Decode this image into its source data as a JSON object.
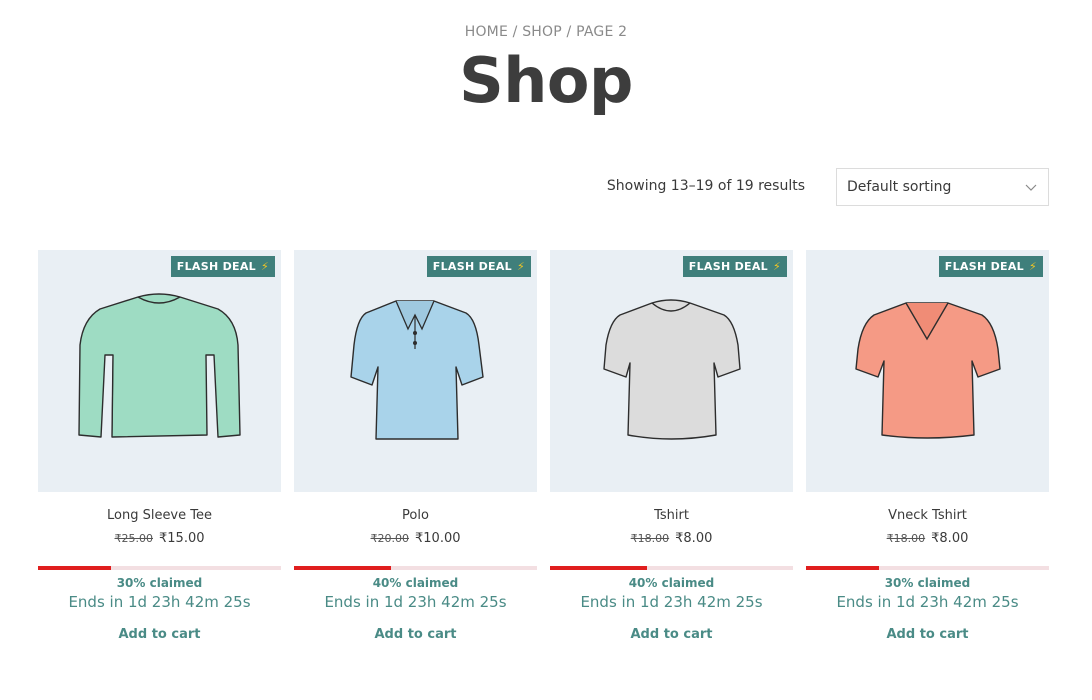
{
  "breadcrumb": {
    "home": "HOME",
    "sep1": " / ",
    "shop": "SHOP",
    "sep2": " / ",
    "page": "PAGE 2"
  },
  "title": "Shop",
  "result_count": "Showing 13–19 of 19 results",
  "sorting": {
    "selected": "Default sorting"
  },
  "colors": {
    "accent": "#3f7f7b",
    "progress": "#e01e1e",
    "thumb_bg": "#e9eff4"
  },
  "products": [
    {
      "badge": "FLASH DEAL",
      "name": "Long Sleeve Tee",
      "old_price": "₹25.00",
      "price": "₹15.00",
      "claimed_pct": 30,
      "claimed": "30% claimed",
      "ends": "Ends in 1d 23h 42m 25s",
      "cta": "Add to cart",
      "shirt_color": "#9edcc3",
      "icon": "long-sleeve-shirt-icon"
    },
    {
      "badge": "FLASH DEAL",
      "name": "Polo",
      "old_price": "₹20.00",
      "price": "₹10.00",
      "claimed_pct": 40,
      "claimed": "40% claimed",
      "ends": "Ends in 1d 23h 42m 25s",
      "cta": "Add to cart",
      "shirt_color": "#a9d3ea",
      "icon": "polo-shirt-icon"
    },
    {
      "badge": "FLASH DEAL",
      "name": "Tshirt",
      "old_price": "₹18.00",
      "price": "₹8.00",
      "claimed_pct": 40,
      "claimed": "40% claimed",
      "ends": "Ends in 1d 23h 42m 25s",
      "cta": "Add to cart",
      "shirt_color": "#dcdcdc",
      "icon": "tshirt-icon"
    },
    {
      "badge": "FLASH DEAL",
      "name": "Vneck Tshirt",
      "old_price": "₹18.00",
      "price": "₹8.00",
      "claimed_pct": 30,
      "claimed": "30% claimed",
      "ends": "Ends in 1d 23h 42m 25s",
      "cta": "Add to cart",
      "shirt_color": "#f59a85",
      "icon": "vneck-tshirt-icon"
    }
  ]
}
